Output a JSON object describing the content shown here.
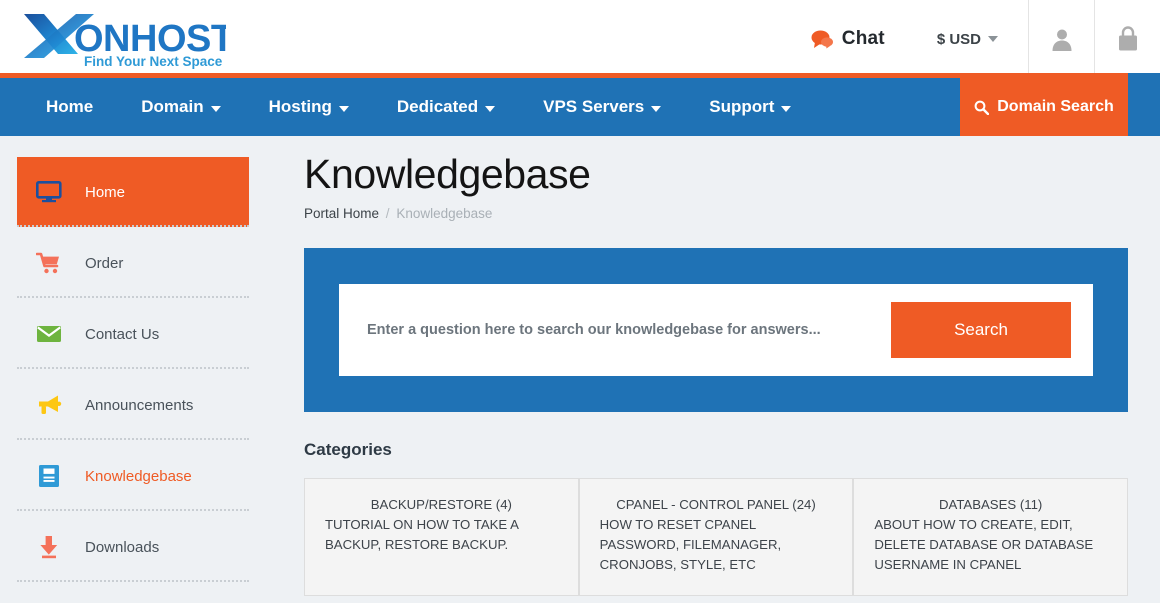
{
  "header": {
    "logo": {
      "brand_main": "ONHOST",
      "brand_x": "X",
      "tagline": "Find Your Next Space"
    },
    "chat_label": "Chat",
    "currency_label": "$ USD",
    "account_icon": "user-icon",
    "cart_icon": "shopping-bag-icon"
  },
  "nav": {
    "items": [
      {
        "label": "Home",
        "caret": false
      },
      {
        "label": "Domain",
        "caret": true
      },
      {
        "label": "Hosting",
        "caret": true
      },
      {
        "label": "Dedicated",
        "caret": true
      },
      {
        "label": "VPS Servers",
        "caret": true
      },
      {
        "label": "Support",
        "caret": true
      }
    ],
    "domain_search_label": "Domain Search",
    "domain_search_icon": "search-icon"
  },
  "sidebar": {
    "items": [
      {
        "label": "Home",
        "icon": "monitor-icon",
        "active": true
      },
      {
        "label": "Order",
        "icon": "shopping-cart-icon",
        "active": false
      },
      {
        "label": "Contact Us",
        "icon": "envelope-icon",
        "active": false
      },
      {
        "label": "Announcements",
        "icon": "megaphone-icon",
        "active": false
      },
      {
        "label": "Knowledgebase",
        "icon": "book-icon",
        "active": false
      },
      {
        "label": "Downloads",
        "icon": "download-icon",
        "active": false
      }
    ]
  },
  "main": {
    "title": "Knowledgebase",
    "breadcrumb": {
      "home": "Portal Home",
      "separator": "/",
      "current": "Knowledgebase"
    },
    "search": {
      "placeholder": "Enter a question here to search our knowledgebase for answers...",
      "value": "",
      "button_label": "Search"
    },
    "categories_heading": "Categories",
    "categories": [
      {
        "title": "BACKUP/RESTORE (4)",
        "description": "TUTORIAL ON HOW TO TAKE A BACKUP, RESTORE BACKUP."
      },
      {
        "title": "CPANEL - CONTROL PANEL (24)",
        "description": "HOW TO RESET CPANEL PASSWORD, FILEMANAGER, CRONJOBS, STYLE, ETC"
      },
      {
        "title": "DATABASES (11)",
        "description": "ABOUT HOW TO CREATE, EDIT, DELETE DATABASE OR DATABASE USERNAME IN CPANEL"
      }
    ]
  },
  "colors": {
    "brand_orange": "#ef5b25",
    "brand_blue": "#1f72b5",
    "page_background": "#eef1f4",
    "card_background": "#f4f4f4"
  }
}
